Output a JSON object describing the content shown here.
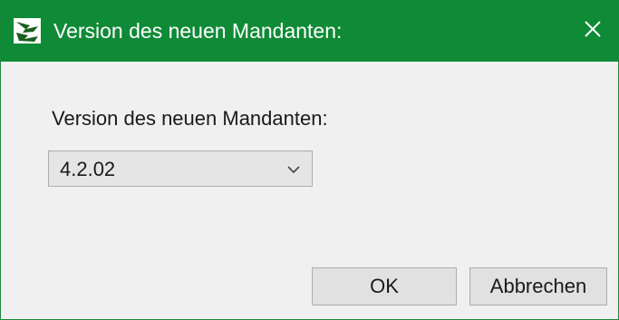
{
  "window": {
    "title": "Version des neuen Mandanten:",
    "accent_color": "#0f8a36"
  },
  "icons": {
    "app": "app-logo-icon",
    "close": "close-icon",
    "dropdown": "chevron-down-icon"
  },
  "form": {
    "label": "Version des neuen Mandanten:",
    "version_select": {
      "selected": "4.2.02"
    }
  },
  "buttons": {
    "ok": "OK",
    "cancel": "Abbrechen"
  }
}
